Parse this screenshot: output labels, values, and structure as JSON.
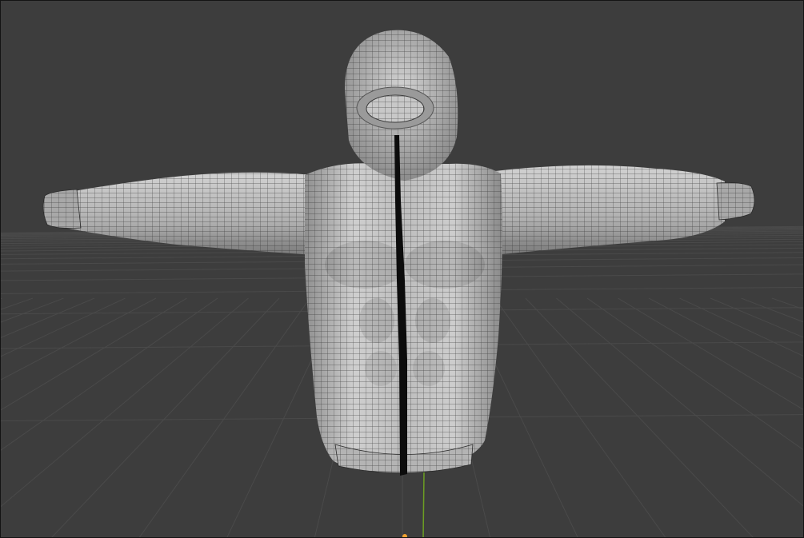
{
  "viewport": {
    "background_color": "#3d3d3d",
    "grid_color": "#4a4a4a",
    "axis_y_color": "#6c9e22",
    "origin_color": "#f0a030",
    "show_floor_grid": true
  },
  "object": {
    "type": "hoodie-mesh",
    "mode": "wireframe-overlay",
    "surface_color": "#c4c4c4",
    "wire_color": "#2a2a2a",
    "zipper_color": "#0c0c0c"
  }
}
